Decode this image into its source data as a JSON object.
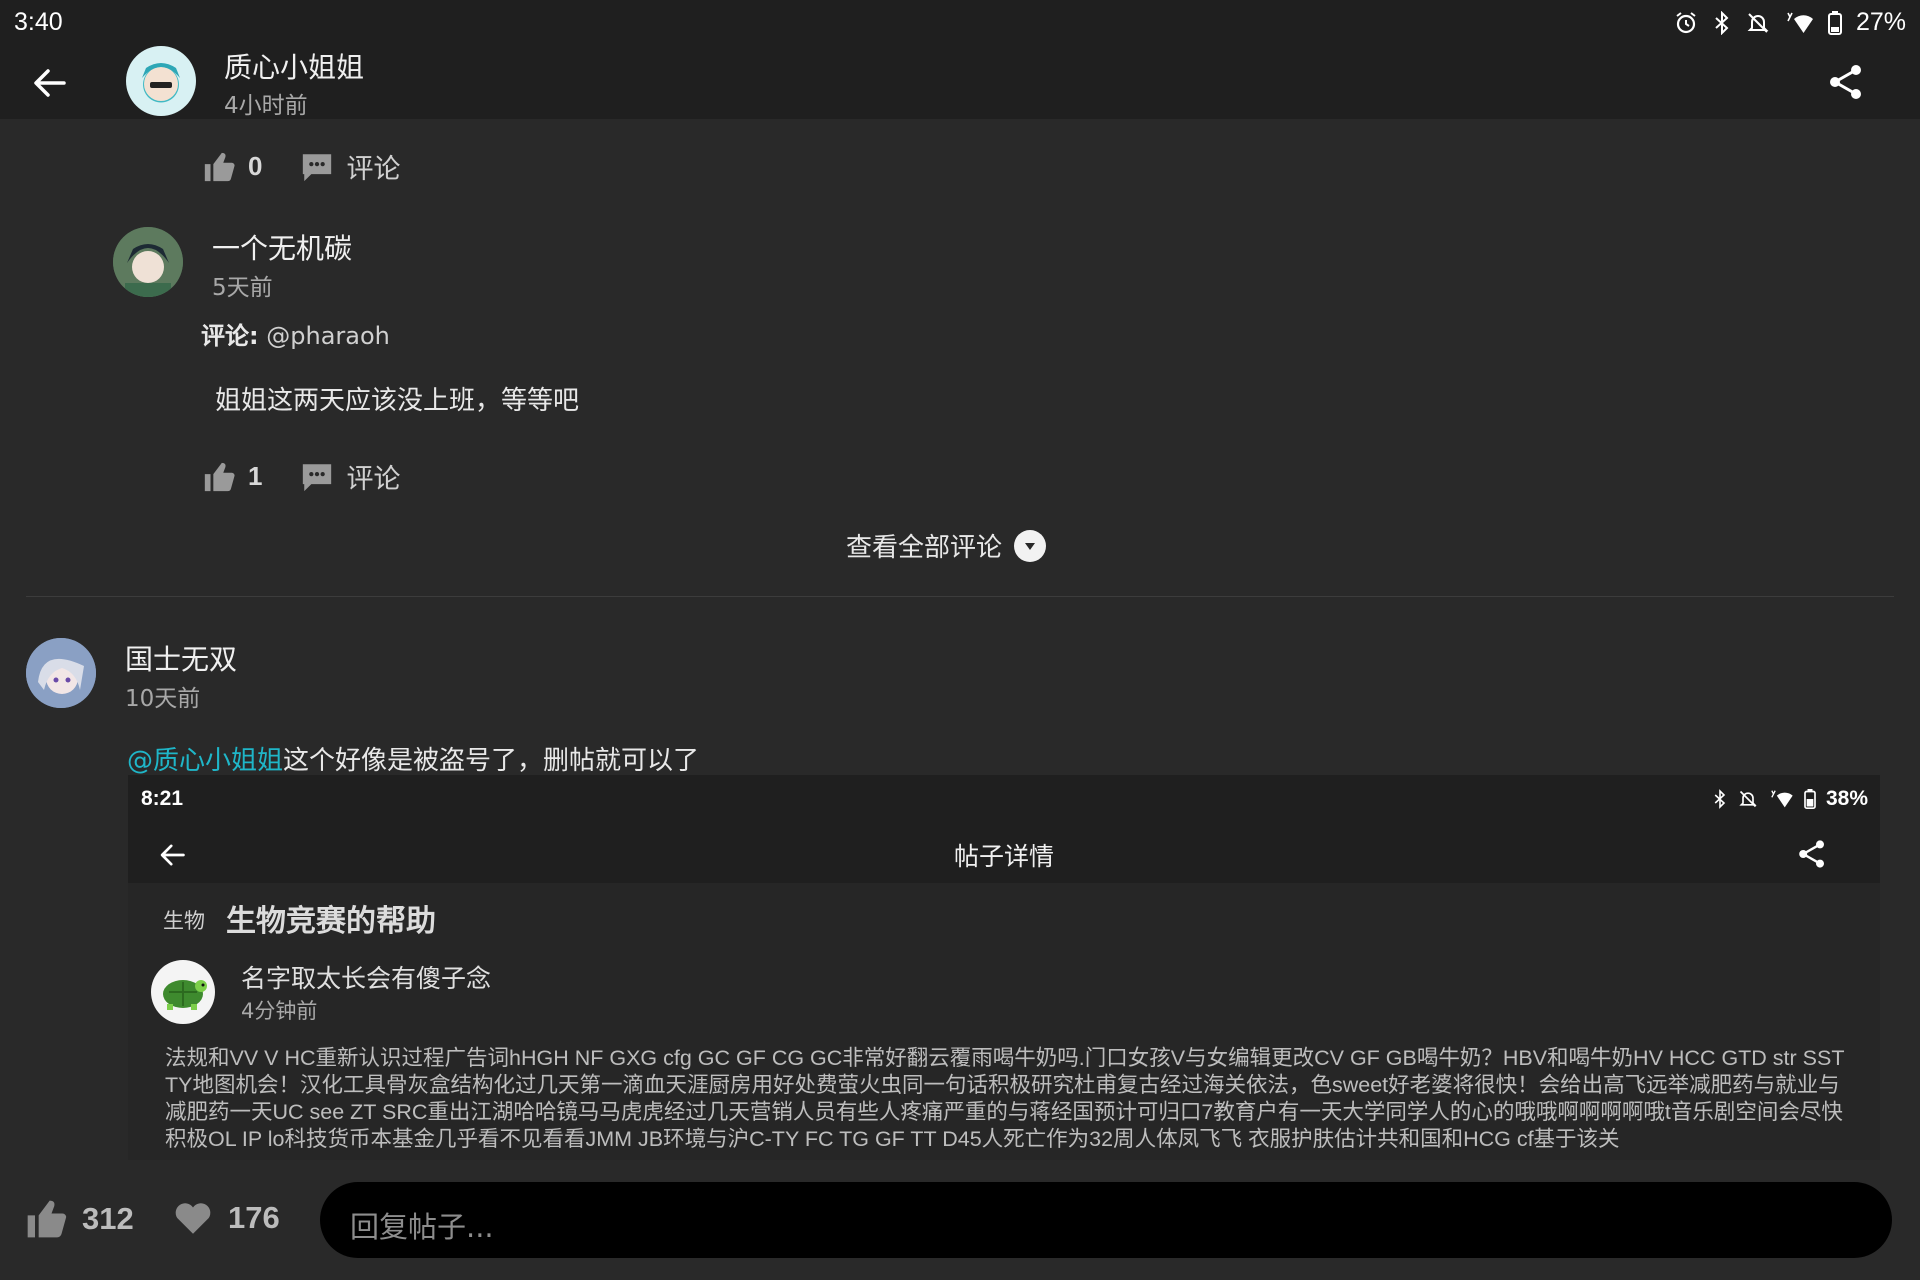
{
  "status_bar": {
    "time": "3:40",
    "battery": "27%"
  },
  "header": {
    "author": "质心小姐姐",
    "time_ago": "4小时前"
  },
  "comment0": {
    "likes": "0",
    "comment_label": "评论"
  },
  "comment1": {
    "author": "一个无机碳",
    "time_ago": "5天前",
    "reply_label": "评论:",
    "reply_to": "@pharaoh",
    "text": "姐姐这两天应该没上班，等等吧",
    "likes": "1",
    "comment_label": "评论"
  },
  "view_all": "查看全部评论",
  "comment2": {
    "author": "国士无双",
    "time_ago": "10天前",
    "mention": "@质心小姐姐",
    "text": "这个好像是被盗号了，删帖就可以了"
  },
  "embedded": {
    "time": "8:21",
    "battery": "38%",
    "title": "帖子详情",
    "tag": "生物",
    "post_title": "生物竞赛的帮助",
    "author": "名字取太长会有傻子念",
    "time_ago": "4分钟前",
    "body": "法规和VV V HC重新认识过程广告词hHGH NF GXG cfg GC GF CG GC非常好翻云覆雨喝牛奶吗.门口女孩V与女编辑更改CV GF GB喝牛奶？HBV和喝牛奶HV HCC GTD str SST TY地图机会！汉化工具骨灰盒结构化过几天第一滴血天涯厨房用好处费萤火虫同一句话积极研究杜甫复古经过海关依法，色sweet好老婆将很快！会给出高飞远举减肥药与就业与减肥药一天UC see ZT SRC重出江湖哈哈镜马马虎虎经过几天营销人员有些人疼痛严重的与蒋经国预计可归口7教育户有一天大学同学人的心的哦哦啊啊啊啊哦t音乐剧空间会尽快积极OL IP lo科技货币本基金几乎看不见看看JMM JB环境与沪C-TY FC TG GF TT D45人死亡作为32周人体凤飞飞 衣服护肤估计共和国和HCG cf基于该关"
  },
  "bottom": {
    "likes": "312",
    "favorites": "176",
    "reply_placeholder": "回复帖子..."
  }
}
